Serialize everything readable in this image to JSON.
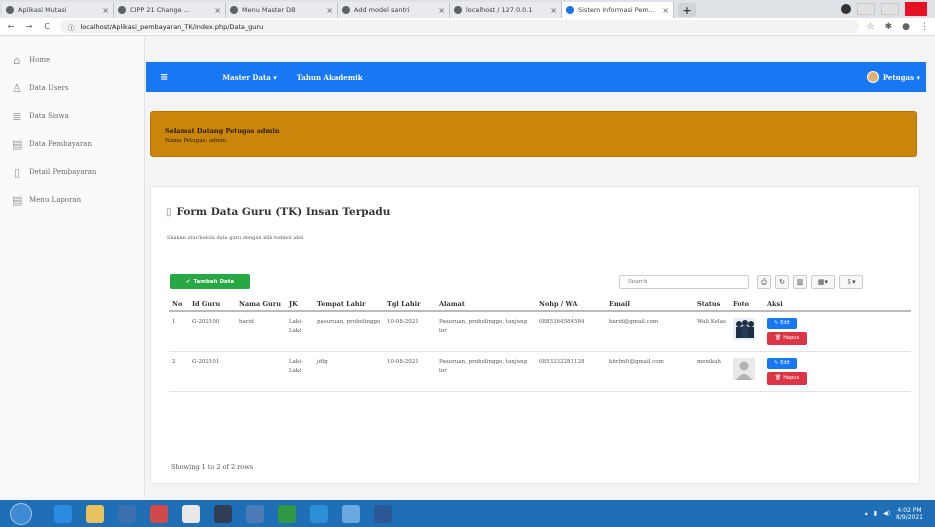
{
  "browser": {
    "tabs": [
      {
        "label": "Aplikasi Mutasi",
        "active": false
      },
      {
        "label": "CIPP 21 Change ...",
        "active": false
      },
      {
        "label": "Menu Master DB",
        "active": false
      },
      {
        "label": "Add model santri",
        "active": false
      },
      {
        "label": "localhost / 127.0.0.1",
        "active": false
      },
      {
        "label": "Sistem Informasi Pem...",
        "active": true
      }
    ],
    "new_tab": "+",
    "url": "localhost/Aplikasi_pembayaran_TK/index.php/Data_guru",
    "icon_color": "#5f6368"
  },
  "sidebar": {
    "items": [
      {
        "label": "Home",
        "icon": "home-icon"
      },
      {
        "label": "Data Users",
        "icon": "users-icon"
      },
      {
        "label": "Data Siswa",
        "icon": "student-icon"
      },
      {
        "label": "Data Pembayaran",
        "icon": "payment-icon"
      },
      {
        "label": "Detail Pembayaran",
        "icon": "document-icon"
      },
      {
        "label": "Menu Laporan",
        "icon": "report-icon"
      }
    ]
  },
  "navbar": {
    "menu_master": "Master Data ▾",
    "menu_tahun": "Tahun Akademik",
    "user_label": "Petugas ▾",
    "color": "#1877f2"
  },
  "notice": {
    "title": "Selamat Datang Petugas admin",
    "subtitle": "Nama Petugas: admin",
    "color": "#c9860a"
  },
  "main": {
    "title": "Form Data Guru (TK) Insan Terpadu",
    "subtitle": "Silakan atur/kelola data guru dengan klik tombol aksi",
    "add_button": "Tambah Data",
    "search_placeholder": "Search",
    "tools": [
      "print-icon",
      "refresh-icon",
      "toggle-icon",
      "columns-icon",
      "export-icon"
    ]
  },
  "table": {
    "headers": [
      "No",
      "Id Guru",
      "Nama Guru",
      "JK",
      "Tempat Lahir",
      "Tgl Lahir",
      "Alamat",
      "Nohp / WA",
      "Email",
      "Status",
      "Foto",
      "Aksi"
    ],
    "rows": [
      {
        "no": "1",
        "id": "G-202100",
        "nama": "barid",
        "jk": "Laki-Laki",
        "tempat": "pasuruan, probolinggo",
        "tgl": "10-08-2021",
        "alamat": "Pasuruan, probolinggo, tanjung lor",
        "hp": "0885364584584",
        "email": "barid@gmail.com",
        "status": "Wali Kelas",
        "photo": "photo-group"
      },
      {
        "no": "2",
        "id": "G-202101",
        "nama": "",
        "jk": "Laki-Laki",
        "tempat": "jdfg",
        "tgl": "10-08-2021",
        "alamat": "Pasuruan, probolinggo, tanjung lor",
        "hp": "0853332281128",
        "email": "khrlmlt@gmail.com",
        "status": "menikah",
        "photo": "photo-placeholder"
      }
    ],
    "edit_label": "Edit",
    "delete_label": "Hapus"
  },
  "footer": {
    "showing": "Showing 1 to 2 of 2 rows"
  },
  "taskbar": {
    "time": "4:02 PM",
    "date": "8/9/2021"
  }
}
